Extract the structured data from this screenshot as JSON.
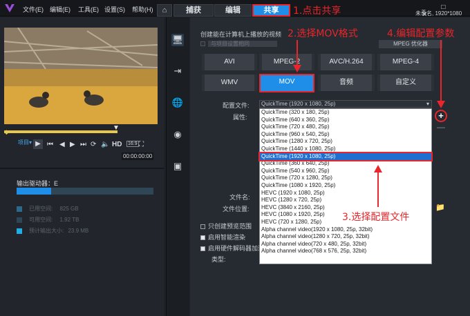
{
  "app": {
    "title_right": "未命名, 1920*1080"
  },
  "menu": [
    "文件(E)",
    "编辑(E)",
    "工具(E)",
    "设置(S)",
    "帮助(H)"
  ],
  "tabs": {
    "capture": "捕获",
    "edit": "编辑",
    "share": "共享"
  },
  "annotations": {
    "a1": "1.点击共享",
    "a2": "2.选择MOV格式",
    "a3": "3.选择配置文件",
    "a4": "4.编辑配置参数"
  },
  "main": {
    "heading": "创建能在计算机上播放的视频",
    "same_as_project": "与项目设置相同",
    "mpeg_opt": "MPEG 优化器",
    "formats": [
      "AVI",
      "MPEG-2",
      "AVC/H.264",
      "MPEG-4",
      "WMV",
      "MOV",
      "音频",
      "自定义"
    ],
    "profile_label": "配置文件:",
    "profile_value": "QuickTime (1920 x 1080, 25p)",
    "attr_label": "属性:",
    "filename_label": "文件名:",
    "location_label": "文件位置:",
    "opt_preview": "只创建预览范围",
    "opt_smart": "启用智能渲染",
    "opt_hw": "启用硬件解码器加速",
    "type_label": "类型:"
  },
  "profiles": [
    "QuickTime (320 x 180, 25p)",
    "QuickTime (640 x 360, 25p)",
    "QuickTime (720 x 480, 25p)",
    "QuickTime (960 x 540, 25p)",
    "QuickTime (1280 x 720, 25p)",
    "QuickTime (1440 x 1080, 25p)",
    "QuickTime (1920 x 1080, 25p)",
    "QuickTime (360 x 640, 25p)",
    "QuickTime (540 x 960, 25p)",
    "QuickTime (720 x 1280, 25p)",
    "QuickTime (1080 x 1920, 25p)",
    "HEVC (1920 x 1080, 25p)",
    "HEVC (1280 x 720, 25p)",
    "HEVC (3840 x 2160, 25p)",
    "HEVC (1080 x 1920, 25p)",
    "HEVC (720 x 1280, 25p)",
    "Alpha channel video(1920 x 1080, 25p, 32bit)",
    "Alpha channel video(1280 x 720, 25p, 32bit)",
    "Alpha channel video(720 x 480, 25p, 32bit)",
    "Alpha channel video(768 x 576, 25p, 32bit)"
  ],
  "selected_profile_index": 6,
  "player": {
    "project_label": "项目▾",
    "timecode": "00:00:00:00",
    "hd": "HD"
  },
  "drive": {
    "label": "输出驱动器：E",
    "used_label": "已用空间:",
    "used": "825 GB",
    "free_label": "可用空间:",
    "free": "1.92 TB",
    "est_label": "预计输出大小:",
    "est": "23.9 MB",
    "used_fraction": 0.25
  },
  "colors": {
    "accent": "#1f8ee8",
    "annotation": "#e8262b"
  }
}
